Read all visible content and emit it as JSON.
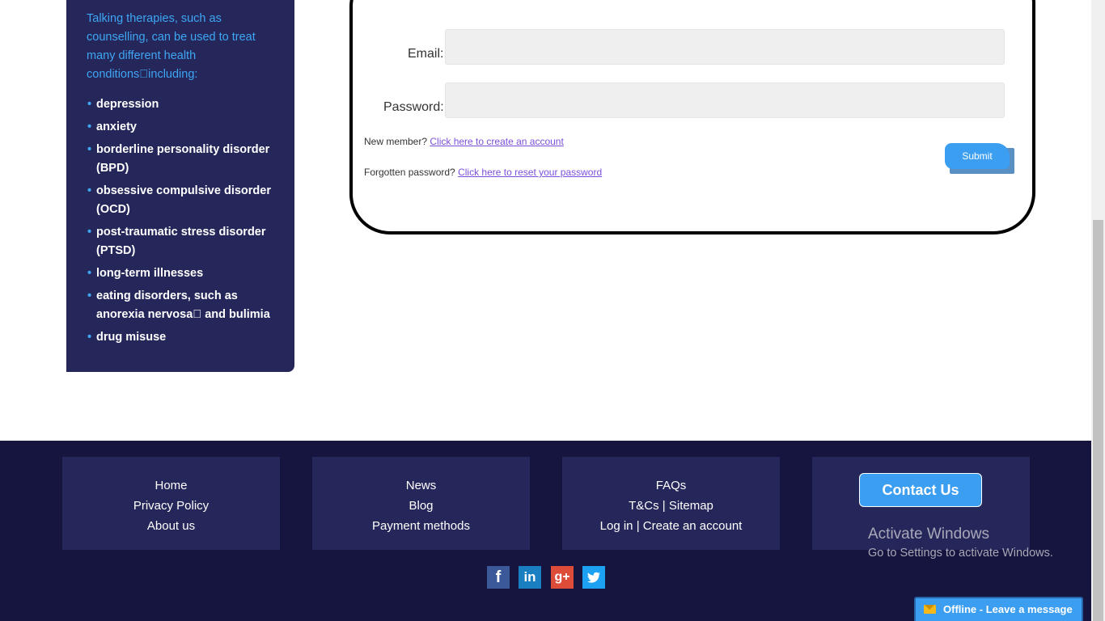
{
  "sidebar": {
    "intro": "Talking therapies, such as counselling, can be used to treat many different health conditions\u0000including:",
    "bullet": "•",
    "items": [
      "depression",
      "anxiety",
      "borderline personality disorder (BPD)",
      "obsessive compulsive disorder (OCD)",
      "post-traumatic stress disorder (PTSD)",
      "long-term illnesses",
      "eating disorders, such as anorexia nervosa\u0000 and bulimia",
      "drug misuse"
    ]
  },
  "form": {
    "email_label": "Email:",
    "email_value": "",
    "password_label": "Password:",
    "password_value": "",
    "new_member_text": "New member?",
    "create_account_link": "Click here to create an account",
    "forgotten_text": "Forgotten password?",
    "reset_link": "Click here to reset your password",
    "submit_label": "Submit"
  },
  "footer": {
    "col1": [
      "Home",
      "Privacy Policy",
      "About us"
    ],
    "col2": [
      "News",
      "Blog",
      "Payment methods"
    ],
    "col3": {
      "faqs": "FAQs",
      "tcs": "T&Cs",
      "sep": "|",
      "sitemap": "Sitemap",
      "login": "Log in",
      "create": "Create an account"
    },
    "contact_label": "Contact Us",
    "social": [
      {
        "icon": "facebook-icon",
        "glyph": "f",
        "color": "#3b5998"
      },
      {
        "icon": "linkedin-icon",
        "glyph": "in",
        "color": "#1a7fc1"
      },
      {
        "icon": "google-plus-icon",
        "glyph": "g+",
        "color": "#dd4b39"
      },
      {
        "icon": "twitter-icon",
        "glyph": "t",
        "color": "#1da1f2"
      }
    ]
  },
  "watermark": {
    "title": "Activate Windows",
    "subtitle": "Go to Settings to activate Windows."
  },
  "chat": {
    "status": "Offline",
    "message": "- Leave a message"
  }
}
